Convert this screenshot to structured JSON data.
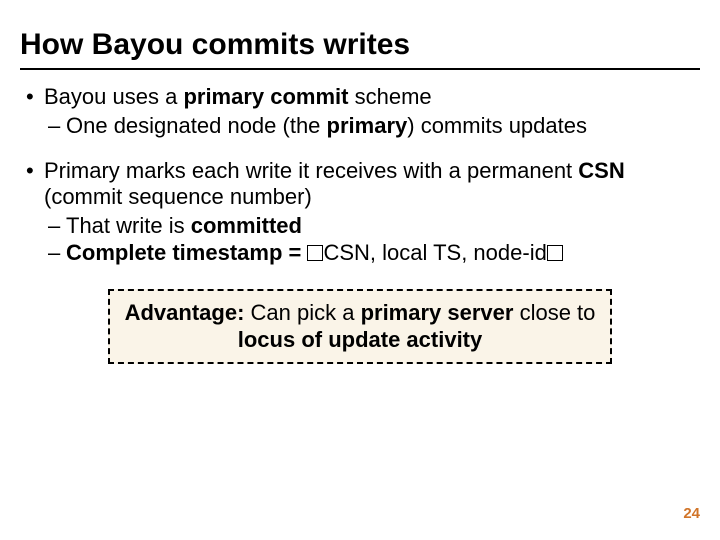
{
  "title": "How Bayou commits writes",
  "bullets": {
    "b1": {
      "pre": "Bayou uses a ",
      "bold": "primary commit",
      "post": " scheme",
      "sub1_pre": "One designated node (the ",
      "sub1_bold": "primary",
      "sub1_post": ") commits updates"
    },
    "b2": {
      "line_pre": "Primary marks each write it receives with a permanent ",
      "csn": "CSN",
      "line_post": " (commit sequence number)",
      "sub1_pre": "That write is ",
      "sub1_bold": "committed",
      "sub2_bold": "Complete timestamp = ",
      "sub2_mid": "CSN, local TS, node-id"
    }
  },
  "callout": {
    "lead": "Advantage:",
    "mid1": " Can pick a ",
    "bold1": "primary server",
    "mid2": " close to ",
    "bold2": "locus of update activity"
  },
  "page_number": "24"
}
